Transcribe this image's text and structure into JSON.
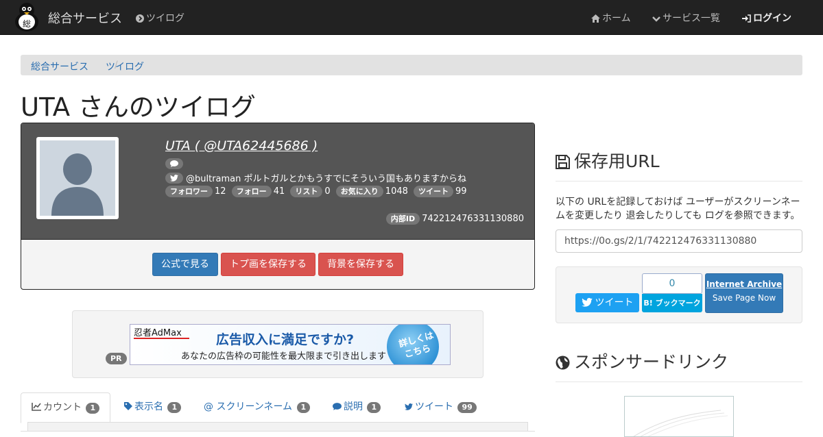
{
  "navbar": {
    "brand": "総合サービス",
    "twilog_link": "ツイログ",
    "items": [
      {
        "label": "ホーム",
        "icon": "home-icon"
      },
      {
        "label": "サービス一覧",
        "icon": "chevron-down-icon"
      },
      {
        "label": "ログイン",
        "icon": "sign-in-icon"
      }
    ]
  },
  "breadcrumb": [
    "総合サービス",
    "ツイログ"
  ],
  "page_title": "UTA さんのツイログ",
  "profile": {
    "display": "UTA ( @UTA62445686 )",
    "latest_tweet": "@bultraman ポルトガルとかもうすでにそういう国もありますからね",
    "stats": [
      {
        "label": "フォロワー",
        "value": "12"
      },
      {
        "label": "フォロー",
        "value": "41"
      },
      {
        "label": "リスト",
        "value": "0"
      },
      {
        "label": "お気に入り",
        "value": "1048"
      },
      {
        "label": "ツイート",
        "value": "99"
      }
    ],
    "internal_id_label": "内部ID",
    "internal_id": "742212476331130880",
    "buttons": {
      "official": "公式で見る",
      "save_avatar": "トプ画を保存する",
      "save_background": "背景を保存する"
    }
  },
  "ad": {
    "pr_label": "PR",
    "brand": "忍者AdMax",
    "headline": "広告収入に満足ですか?",
    "subline": "あなたの広告枠の可能性を最大限まで引き出します",
    "cta_line1": "詳しくは",
    "cta_line2": "こちら"
  },
  "tabs": [
    {
      "label": "カウント",
      "count": "1",
      "icon": "chart-icon"
    },
    {
      "label": "表示名",
      "count": "1",
      "icon": "tag-icon"
    },
    {
      "label": "@ スクリーンネーム",
      "count": "1",
      "icon": "at-icon"
    },
    {
      "label": "説明",
      "count": "1",
      "icon": "comment-icon"
    },
    {
      "label": "ツイート",
      "count": "99",
      "icon": "twitter-icon"
    }
  ],
  "sidebar": {
    "save_url_heading": "保存用URL",
    "save_url_desc": "以下の URLを記録しておけば ユーザーがスクリーンネームを変更したり 退会したりしても ログを参照できます。",
    "save_url_value": "https://0o.gs/2/1/742212476331130880",
    "share": {
      "tweet_label": "ツイート",
      "hatena_count": "0",
      "hatena_label": "B! ブックマーク",
      "archive_title": "Internet Archive",
      "archive_sub": "Save Page Now"
    },
    "sponsor_heading": "スポンサードリンク"
  },
  "colors": {
    "navbar_bg": "#222222",
    "primary": "#337ab7",
    "danger": "#d9534f",
    "profile_bg": "#555555",
    "twitter": "#1da1f2",
    "hatena": "#00a4de"
  }
}
